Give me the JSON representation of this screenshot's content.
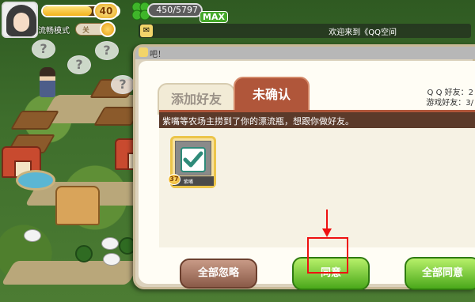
{
  "hud": {
    "level": "40",
    "exp_fraction": 0.65,
    "clover_count": "450/5797",
    "max_label": "MAX",
    "mode_label": "流畅模式",
    "mode_toggle_text": "关",
    "ticker_text": "欢迎来到《QQ空间"
  },
  "dialog": {
    "title": "吧！",
    "tabs": [
      {
        "label": "添加好友",
        "active": false
      },
      {
        "label": "未确认",
        "active": true
      }
    ],
    "friend_stats": {
      "qq_friends": "Q Q 好友：2",
      "game_friends": "游戏好友：3/"
    },
    "message": "紫嘴等农场主捞到了你的漂流瓶，想跟你做好友。",
    "friend_card": {
      "level": "37",
      "name": "紫嘴"
    },
    "buttons": {
      "ignore_all": "全部忽略",
      "agree": "同意",
      "agree_all": "全部同意"
    }
  },
  "colors": {
    "tab_active": "#b0563a",
    "highlight": "#ee1111",
    "agree_green": "#4aa81a"
  }
}
